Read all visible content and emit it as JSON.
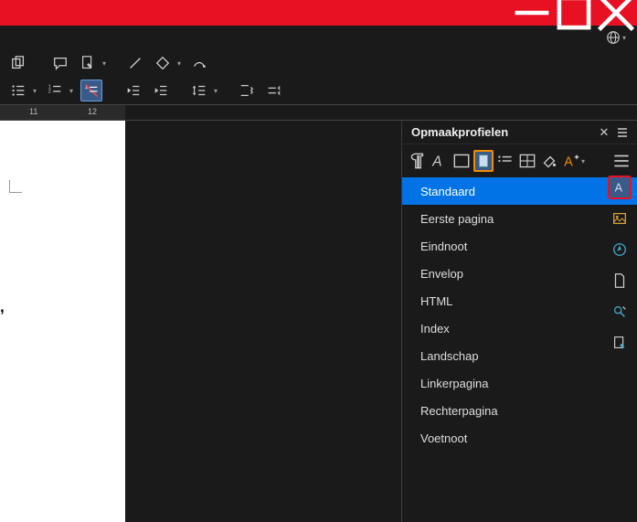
{
  "sidebar": {
    "title": "Opmaakprofielen",
    "styles": [
      "Standaard",
      "Eerste pagina",
      "Eindnoot",
      "Envelop",
      "HTML",
      "Index",
      "Landschap",
      "Linkerpagina",
      "Rechterpagina",
      "Voetnoot"
    ],
    "selected_index": 0
  },
  "ruler": {
    "marks": [
      "11",
      "12"
    ]
  },
  "page": {
    "line1": ",",
    "line2": ""
  }
}
